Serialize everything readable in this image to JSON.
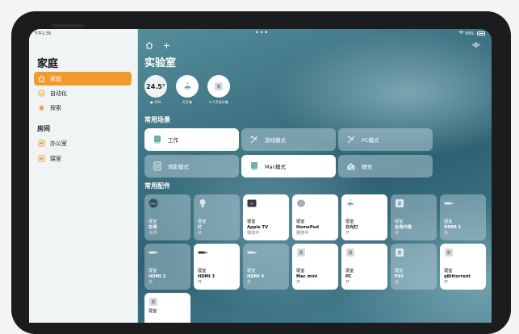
{
  "status": {
    "time": "下午1:35",
    "battery": "99%"
  },
  "sidebar": {
    "title": "家庭",
    "items": [
      {
        "label": "家庭",
        "icon": "house-icon"
      },
      {
        "label": "自动化",
        "icon": "clock-check-icon"
      },
      {
        "label": "探索",
        "icon": "star-icon"
      }
    ],
    "section_title": "房间",
    "rooms": [
      {
        "label": "办公室",
        "icon": "room-icon"
      },
      {
        "label": "寝室",
        "icon": "room-icon"
      }
    ]
  },
  "main": {
    "room_title": "实验室",
    "summary": {
      "temperature": "24.5°",
      "humidity": "16%",
      "lights_caption": "灯开着",
      "switches_caption": "4 个开关开着"
    },
    "scenes_label": "常用场景",
    "scenes": [
      {
        "label": "工作",
        "on": true
      },
      {
        "label": "游戏模式",
        "on": false
      },
      {
        "label": "PC模式",
        "on": false
      },
      {
        "label": "观影模式",
        "on": false
      },
      {
        "label": "Mac模式",
        "on": true
      },
      {
        "label": "睡觉",
        "on": false
      }
    ],
    "accessories_label": "常用配件",
    "accessories": [
      {
        "room": "寝室",
        "name": "空调",
        "state": "关闭",
        "on": false,
        "icon": "thermostat-icon"
      },
      {
        "room": "寝室",
        "name": "灯",
        "state": "关",
        "on": false,
        "icon": "lightbulb-icon"
      },
      {
        "room": "寝室",
        "name": "Apple TV",
        "state": "播放中",
        "on": true,
        "icon": "appletv-icon"
      },
      {
        "room": "寝室",
        "name": "HomePod",
        "state": "播放中",
        "on": true,
        "icon": "homepod-icon"
      },
      {
        "room": "寝室",
        "name": "日光灯",
        "state": "开",
        "on": true,
        "icon": "ceiling-lamp-icon"
      },
      {
        "room": "寝室",
        "name": "全局代理",
        "state": "关",
        "on": false,
        "icon": "switch-icon"
      },
      {
        "room": "寝室",
        "name": "HDMI 1",
        "state": "关",
        "on": false,
        "icon": "hdmi-icon"
      },
      {
        "room": "寝室",
        "name": "HDMI 2",
        "state": "关",
        "on": false,
        "icon": "hdmi-icon"
      },
      {
        "room": "寝室",
        "name": "HDMI 3",
        "state": "开",
        "on": true,
        "icon": "hdmi-icon"
      },
      {
        "room": "寝室",
        "name": "HDMI 4",
        "state": "关",
        "on": false,
        "icon": "hdmi-icon"
      },
      {
        "room": "寝室",
        "name": "Mac mini",
        "state": "开",
        "on": true,
        "icon": "switch-icon"
      },
      {
        "room": "寝室",
        "name": "PC",
        "state": "开",
        "on": true,
        "icon": "switch-icon"
      },
      {
        "room": "寝室",
        "name": "PS5",
        "state": "关",
        "on": false,
        "icon": "switch-icon"
      },
      {
        "room": "寝室",
        "name": "qBittorrent",
        "state": "开",
        "on": true,
        "icon": "switch-icon"
      },
      {
        "room": "寝室",
        "name": "",
        "state": "",
        "on": true,
        "icon": "switch-icon"
      }
    ]
  },
  "colors": {
    "accent": "#f29a2e",
    "sidebar_bg": "#f0f4f5",
    "tile_on": "#ffffff"
  }
}
